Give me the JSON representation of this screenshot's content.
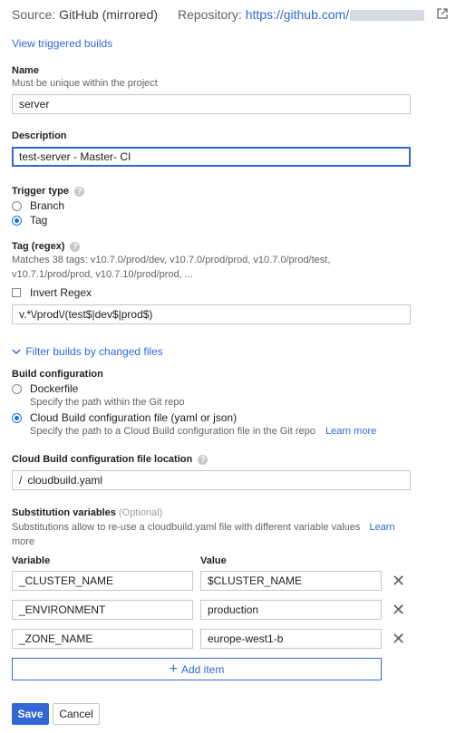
{
  "header": {
    "source_label": "Source:",
    "source_value": "GitHub (mirrored)",
    "repo_label": "Repository:",
    "repo_url": "https://github.com/"
  },
  "view_triggered_builds": "View triggered builds",
  "name": {
    "label": "Name",
    "hint": "Must be unique within the project",
    "value": "server"
  },
  "description": {
    "label": "Description",
    "value": "test-server - Master- CI"
  },
  "trigger_type": {
    "label": "Trigger type",
    "options": [
      "Branch",
      "Tag"
    ],
    "selected": "Tag"
  },
  "tag_regex": {
    "label": "Tag (regex)",
    "matches_line1": "Matches 38 tags: v10.7.0/prod/dev, v10.7.0/prod/prod, v10.7.0/prod/test,",
    "matches_line2": "v10.7.1/prod/prod, v10.7.10/prod/prod, ...",
    "invert_label": "Invert Regex",
    "invert_checked": false,
    "value": "v.*\\/prod\\/(test$|dev$|prod$)"
  },
  "filter_builds": "Filter builds by changed files",
  "build_config": {
    "label": "Build configuration",
    "options": [
      {
        "label": "Dockerfile",
        "desc": "Specify the path within the Git repo",
        "selected": false
      },
      {
        "label": "Cloud Build configuration file (yaml or json)",
        "desc": "Specify the path to a Cloud Build configuration file in the Git repo",
        "selected": true
      }
    ],
    "learn_more": "Learn more"
  },
  "config_location": {
    "label": "Cloud Build configuration file location",
    "prefix": "/",
    "value": "cloudbuild.yaml"
  },
  "substitutions": {
    "label": "Substitution variables",
    "optional": "(Optional)",
    "desc": "Substitutions allow to re-use a cloudbuild.yaml file with different variable values",
    "learn": "Learn",
    "more": "more",
    "col_variable": "Variable",
    "col_value": "Value",
    "rows": [
      {
        "variable": "_CLUSTER_NAME",
        "value": "$CLUSTER_NAME"
      },
      {
        "variable": "_ENVIRONMENT",
        "value": "production"
      },
      {
        "variable": "_ZONE_NAME",
        "value": "europe-west1-b"
      }
    ],
    "add_item": "Add item"
  },
  "actions": {
    "save": "Save",
    "cancel": "Cancel"
  },
  "colors": {
    "accent": "#3367d6",
    "radio": "#1a73e8"
  }
}
